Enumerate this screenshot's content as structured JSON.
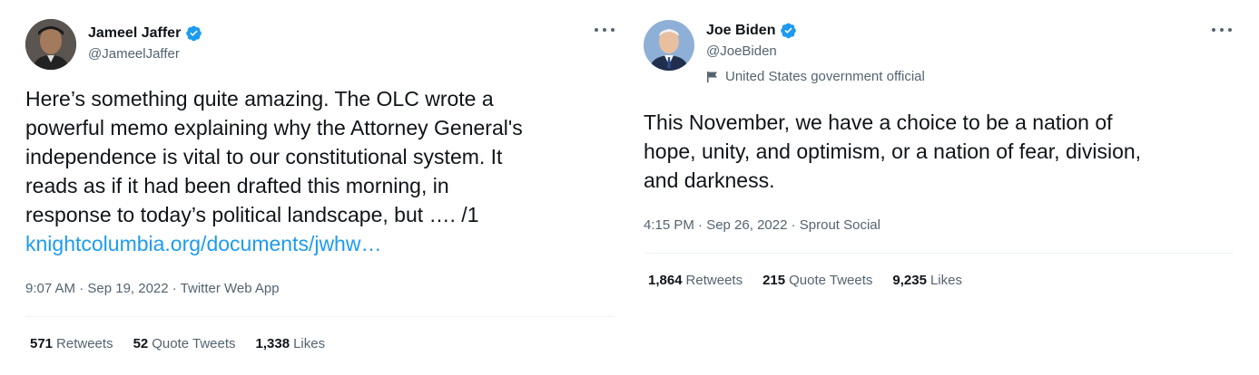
{
  "tweets": [
    {
      "display_name": "Jameel Jaffer",
      "handle": "@JameelJaffer",
      "text_lines": [
        "Here’s something quite amazing. The OLC wrote a",
        "powerful memo explaining why the Attorney General's",
        "independence is vital to our constitutional system. It",
        "reads as if it had been drafted this morning, in",
        "response to today’s political landscape, but …. /1"
      ],
      "link": "knightcolumbia.org/documents/jwhw…",
      "meta": "9:07 AM · Sep 19, 2022 · Twitter Web App",
      "stats": {
        "retweets_count": "571",
        "retweets_label": "Retweets",
        "quotes_count": "52",
        "quotes_label": "Quote Tweets",
        "likes_count": "1,338",
        "likes_label": "Likes"
      }
    },
    {
      "display_name": "Joe Biden",
      "handle": "@JoeBiden",
      "label": "United States government official",
      "text_lines": [
        "This November, we have a choice to be a nation of",
        "hope, unity, and optimism, or a nation of fear, division,",
        "and darkness."
      ],
      "meta": "4:15 PM · Sep 26, 2022 · Sprout Social",
      "stats": {
        "retweets_count": "1,864",
        "retweets_label": "Retweets",
        "quotes_count": "215",
        "quotes_label": "Quote Tweets",
        "likes_count": "9,235",
        "likes_label": "Likes"
      }
    }
  ],
  "colors": {
    "verified": "#1d9bf0",
    "link": "#1d9bf0",
    "secondary_text": "#536471",
    "primary_text": "#0f1419"
  },
  "icons": {
    "verified": "verified-badge-icon",
    "more": "more-options-icon",
    "flag": "government-flag-icon"
  }
}
